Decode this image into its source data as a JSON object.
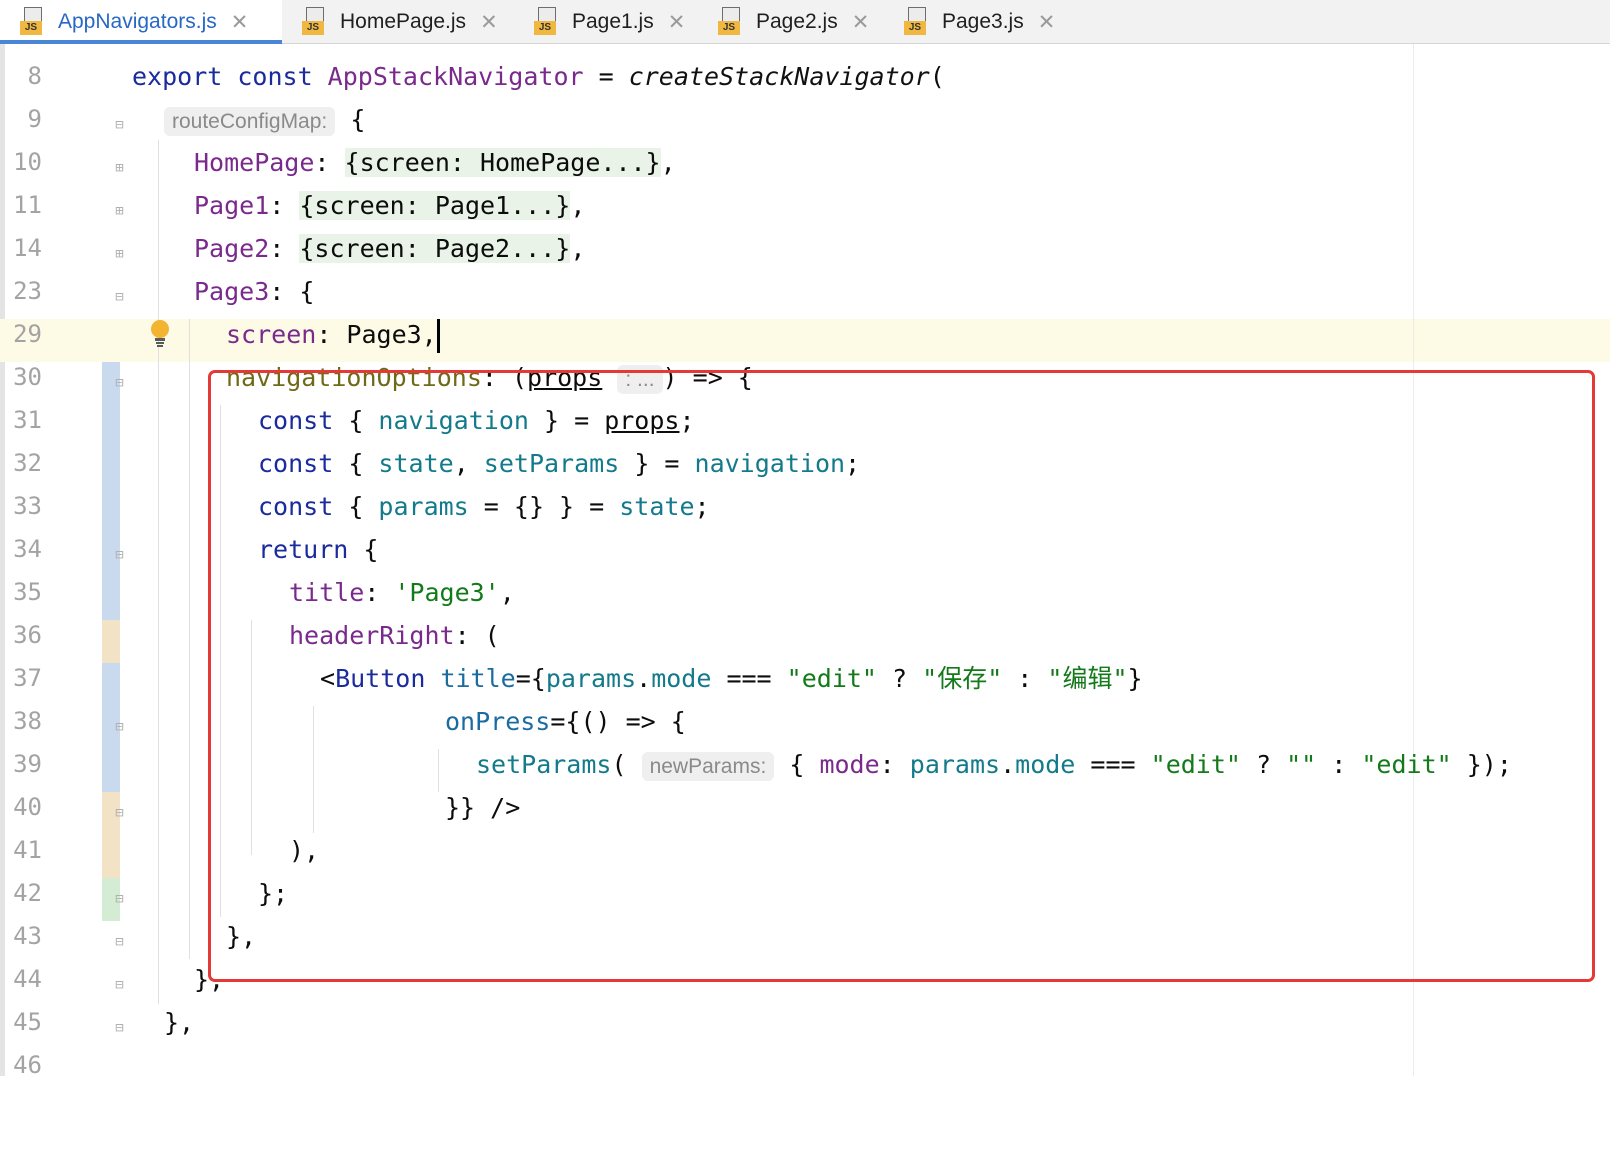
{
  "tabs": [
    {
      "label": "AppNavigators.js",
      "active": true
    },
    {
      "label": "HomePage.js",
      "active": false
    },
    {
      "label": "Page1.js",
      "active": false
    },
    {
      "label": "Page2.js",
      "active": false
    },
    {
      "label": "Page3.js",
      "active": false
    }
  ],
  "tab_icon_badge": "JS",
  "tab_close_glyph": "✕",
  "editor": {
    "top_partial_line_number": "8",
    "line_numbers": [
      "9",
      "10",
      "11",
      "14",
      "23",
      "29",
      "30",
      "31",
      "32",
      "33",
      "34",
      "35",
      "36",
      "37",
      "38",
      "39",
      "40",
      "41",
      "42",
      "43",
      "44",
      "45",
      "46"
    ],
    "current_line": "30",
    "hints": {
      "route_config_map": "routeConfigMap:",
      "props_type": ": ...",
      "new_params": "newParams:"
    },
    "folded_placeholders": {
      "home": "{screen: HomePage...}",
      "page1": "{screen: Page1...}",
      "page2": "{screen: Page2...}"
    },
    "strings": {
      "title_value": "'Page3'",
      "edit": "\"edit\"",
      "save_cn": "\"保存\"",
      "edit_cn": "\"编辑\"",
      "empty": "\"\""
    }
  },
  "colors": {
    "keyword": "#1a2b9c",
    "property": "#7a2a8c",
    "variable": "#137a8c",
    "string": "#137a1a",
    "highlight_box": "#e53935",
    "active_tab_text": "#2768c4",
    "caret_line": "#fdfbe6"
  }
}
